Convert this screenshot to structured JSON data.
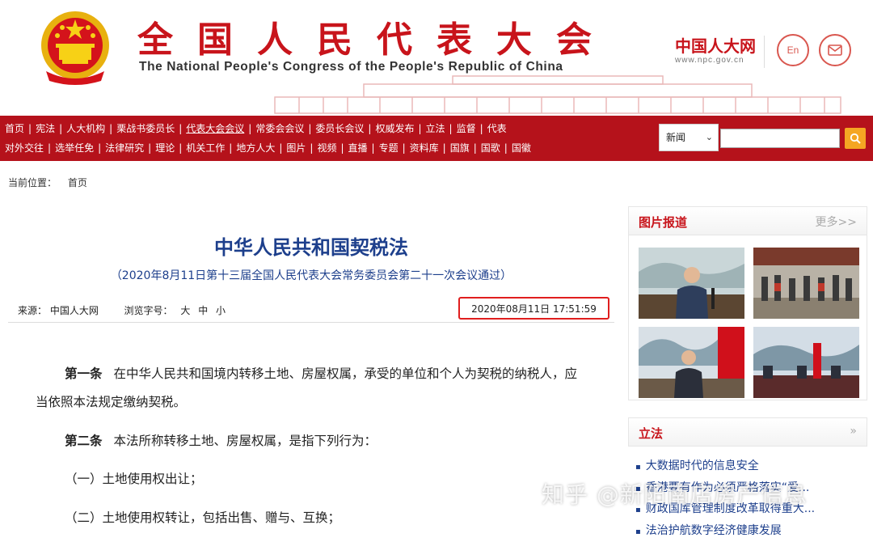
{
  "header": {
    "title_cn": "全国人民代表大会",
    "title_en": "The National People's Congress of the People's Republic of China",
    "logo_cn": "中国人大网",
    "logo_url": "www.npc.gov.cn",
    "en_label": "En"
  },
  "nav": {
    "row1": [
      "首页",
      "宪法",
      "人大机构",
      "栗战书委员长",
      "代表大会会议",
      "常委会会议",
      "委员长会议",
      "权威发布",
      "立法",
      "监督",
      "代表"
    ],
    "row2": [
      "对外交往",
      "选举任免",
      "法律研究",
      "理论",
      "机关工作",
      "地方人大",
      "图片",
      "视频",
      "直播",
      "专题",
      "资料库",
      "国旗",
      "国歌",
      "国徽"
    ],
    "active": "代表大会会议"
  },
  "search": {
    "selected": "新闻",
    "placeholder": ""
  },
  "breadcrumb": {
    "label": "当前位置：",
    "home": "首页"
  },
  "article": {
    "title": "中华人民共和国契税法",
    "subtitle": "（2020年8月11日第十三届全国人民代表大会常务委员会第二十一次会议通过）",
    "source_label": "来源：",
    "source": "中国人大网",
    "fontsize_label": "浏览字号：",
    "fontsize_large": "大",
    "fontsize_medium": "中",
    "fontsize_small": "小",
    "datetime": "2020年08月11日 17:51:59",
    "p1_lead": "第一条",
    "p1_text": "在中华人民共和国境内转移土地、房屋权属，承受的单位和个人为契税的纳税人，应当依照本法规定缴纳契税。",
    "p2_lead": "第二条",
    "p2_text": "本法所称转移土地、房屋权属，是指下列行为：",
    "p3_text": "（一）土地使用权出让；",
    "p4_text": "（二）土地使用权转让，包括出售、赠与、互换；"
  },
  "sidebar": {
    "photo_title": "图片报道",
    "photo_more": "更多>>",
    "law_title": "立法",
    "law_more": "»",
    "news": [
      "大数据时代的信息安全",
      "香港要有作为必须严格落实“爱...",
      "财政国库管理制度改革取得重大...",
      "法治护航数字经济健康发展"
    ]
  },
  "watermark": "知乎 @新阳南店房产信息",
  "colors": {
    "brand_red": "#c8141b",
    "nav_red": "#b5121b",
    "link_blue": "#1d3f8c",
    "highlight_box": "#e01e1e",
    "search_button": "#f5a623"
  }
}
